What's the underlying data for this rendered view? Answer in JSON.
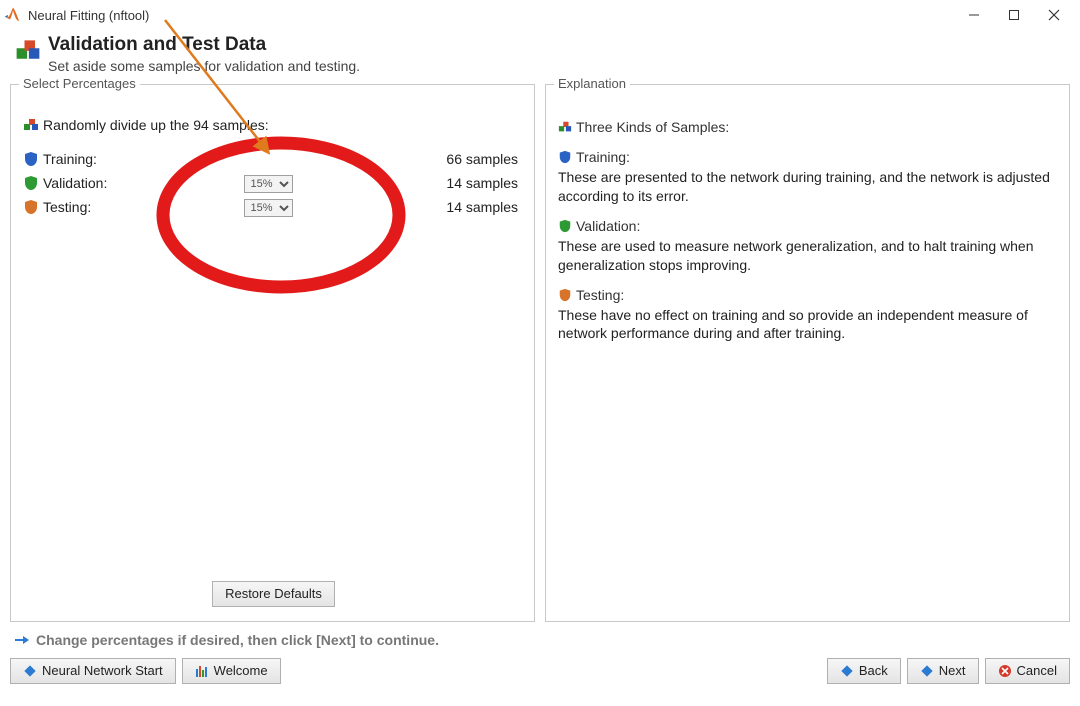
{
  "window": {
    "title": "Neural Fitting (nftool)"
  },
  "header": {
    "title": "Validation and Test Data",
    "subtitle": "Set aside some samples for validation and testing."
  },
  "left": {
    "legend": "Select Percentages",
    "intro_prefix": "Randomly divide up the ",
    "sample_count": "94",
    "intro_suffix": " samples:",
    "training_label": "Training:",
    "validation_label": "Validation:",
    "testing_label": "Testing:",
    "validation_pct": "15%",
    "testing_pct": "15%",
    "training_samples": "66 samples",
    "validation_samples": "14 samples",
    "testing_samples": "14 samples",
    "restore_button": "Restore Defaults"
  },
  "right": {
    "legend": "Explanation",
    "kinds_heading": "Three Kinds of Samples:",
    "training_heading": "Training:",
    "training_text": "These are presented to the network during training, and the network is adjusted according to its error.",
    "validation_heading": "Validation:",
    "validation_text": "These are used to measure network generalization, and to halt training when generalization stops improving.",
    "testing_heading": "Testing:",
    "testing_text": "These have no effect on training and so provide an independent measure of network performance during and after training."
  },
  "hint": "Change percentages if desired, then click [Next] to continue.",
  "footer": {
    "nn_start": "Neural Network Start",
    "welcome": "Welcome",
    "back": "Back",
    "next": "Next",
    "cancel": "Cancel"
  }
}
